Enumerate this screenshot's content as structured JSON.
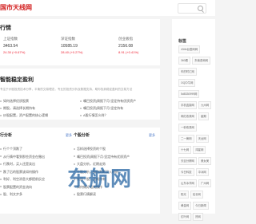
{
  "site": {
    "logo": "国市天线网",
    "search_placeholder": ""
  },
  "market": {
    "title": "行情",
    "indices": [
      {
        "name": "上证指数",
        "value": "3463.54",
        "change": "24.30 (+0.67%)"
      },
      {
        "name": "深证指数",
        "value": "10585.19",
        "change": "28.40 (+0.27%)"
      },
      {
        "name": "创业板指",
        "value": "2156.08",
        "change": "8.91 (+0.41%)"
      }
    ]
  },
  "hero": {
    "title": "智能稳定盈利",
    "description": "专注于炒股投资技术分享，平衡的交易理念，专业的投资分析及数据支持，助你找到稳定盈利的交易方法"
  },
  "news": {
    "left": [
      "如何选择优质股票",
      "期股，请选择长期持有",
      "炒股配置，资产配置的核心逻辑"
    ],
    "right": [
      "嘴巴投资|周报下月:坚定持有优质资产",
      "嘴巴投资|周报下月:坚定持有",
      "A股行情怎么样？"
    ]
  },
  "bottom": {
    "left_title": "行分析",
    "left_more": "更多",
    "left_items": [
      "行个个顶跌了",
      "从行情中看到那些资金在撤出",
      "行跌时，买入还是卖出",
      "跌了后的股票该如何操作",
      "利好、利空消息大都提前反应",
      "股票配置的资金流向",
      "股、利文步多"
    ],
    "right_title": "个股分析",
    "right_more": "更多",
    "right_items": [
      "怎样选择投资的个股",
      "嘴巴投资|周报下月:坚定持有优质资产",
      "大盘分析，近期走势",
      "个股分析，如何判断买入时机",
      "优质个股，长线持有",
      "如何做好短线操作",
      "股票行情解读"
    ]
  },
  "watermark": "东航网",
  "sidebar": {
    "title": "标签",
    "tags": [
      "434b台登网网",
      "360看",
      "东南咨询网",
      "车的时汇网",
      "OQ中牛网",
      "5d8330999网",
      "手机连接网",
      "九州网",
      "网红收录网",
      "星期",
      "一秒收录网",
      "二一黄网",
      "天台网",
      "十七网",
      "鸿星网",
      "天目分辨网",
      "美女美",
      "今日科技",
      "中冰网",
      "山东冰洋网",
      "广州网",
      "阳光",
      "站长网",
      "黄金网",
      "今日新闻",
      "红叶网",
      "热网"
    ]
  }
}
